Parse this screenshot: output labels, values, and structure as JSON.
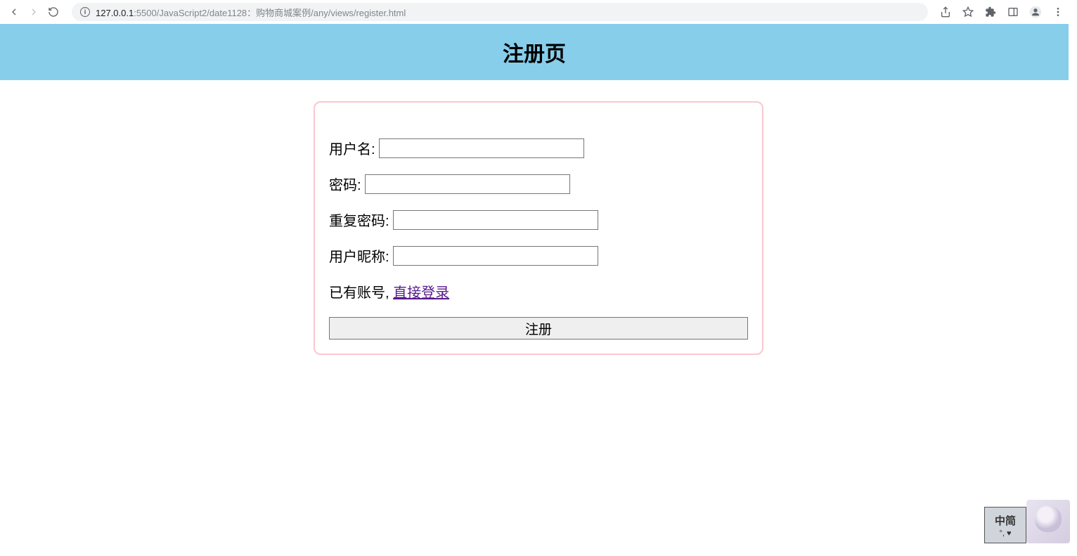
{
  "browser": {
    "url_host": "127.0.0.1",
    "url_port_path": ":5500/JavaScript2/date1128：购物商城案例/any/views/register.html"
  },
  "header": {
    "title": "注册页"
  },
  "form": {
    "username_label": "用户名:",
    "password_label": "密码:",
    "repeat_password_label": "重复密码:",
    "nickname_label": "用户昵称:",
    "has_account_text": "已有账号, ",
    "login_link_text": "直接登录",
    "submit_label": "注册"
  },
  "ime": {
    "top": "中简",
    "bottom": "°, ♥"
  }
}
